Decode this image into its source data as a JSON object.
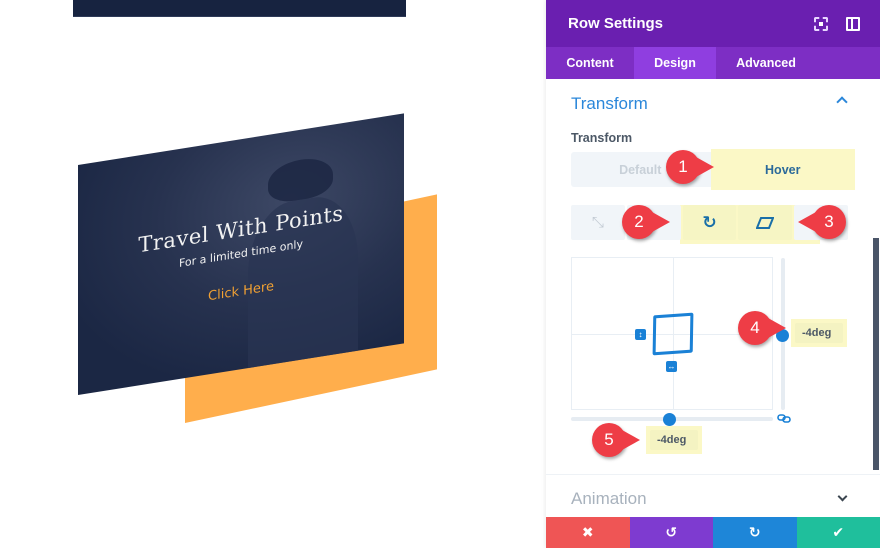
{
  "canvas": {
    "card": {
      "title": "Travel With Points",
      "subtitle": "For a limited time only",
      "cta_label": "Click Here"
    },
    "colors": {
      "card_bg": "#1b2744",
      "accent_orange": "#ffae4c",
      "cta_text": "#f0a033"
    }
  },
  "panel": {
    "title": "Row Settings",
    "header_icons": [
      "focus-mode-icon",
      "split-view-icon"
    ],
    "tabs": [
      {
        "label": "Content",
        "active": false
      },
      {
        "label": "Design",
        "active": true
      },
      {
        "label": "Advanced",
        "active": false
      }
    ],
    "transform_section": {
      "heading": "Transform",
      "expanded": true,
      "field_label": "Transform",
      "state_toggle": {
        "default_label": "Default",
        "hover_label": "Hover",
        "selected": "Hover"
      },
      "tools": [
        {
          "name": "scale-icon",
          "glyph": "⤡",
          "active": false
        },
        {
          "name": "translate-icon",
          "glyph": "",
          "active": false
        },
        {
          "name": "rotate-icon",
          "glyph": "↻",
          "active": true
        },
        {
          "name": "skew-icon",
          "glyph": "▱",
          "active": true
        },
        {
          "name": "origin-icon",
          "glyph": "",
          "active": false
        }
      ],
      "skew_y_value": "-4deg",
      "skew_x_value": "-4deg",
      "vertical_handle_glyph": "↕",
      "horizontal_handle_glyph": "↔"
    },
    "animation_section": {
      "heading": "Animation",
      "expanded": false
    },
    "footer": {
      "cancel_glyph": "✖",
      "undo_glyph": "↺",
      "redo_glyph": "↻",
      "save_glyph": "✔"
    },
    "colors": {
      "header_bg": "#6a1fb0",
      "tabs_bg": "#7d2ec4",
      "active_tab_bg": "#8f3ee0",
      "accent_blue": "#2b87da",
      "cancel": "#ef5555",
      "undo": "#7e3bd0",
      "redo": "#1e86d8",
      "save": "#1fbf9c"
    }
  },
  "annotations": [
    {
      "number": "1"
    },
    {
      "number": "2"
    },
    {
      "number": "3"
    },
    {
      "number": "4"
    },
    {
      "number": "5"
    }
  ]
}
